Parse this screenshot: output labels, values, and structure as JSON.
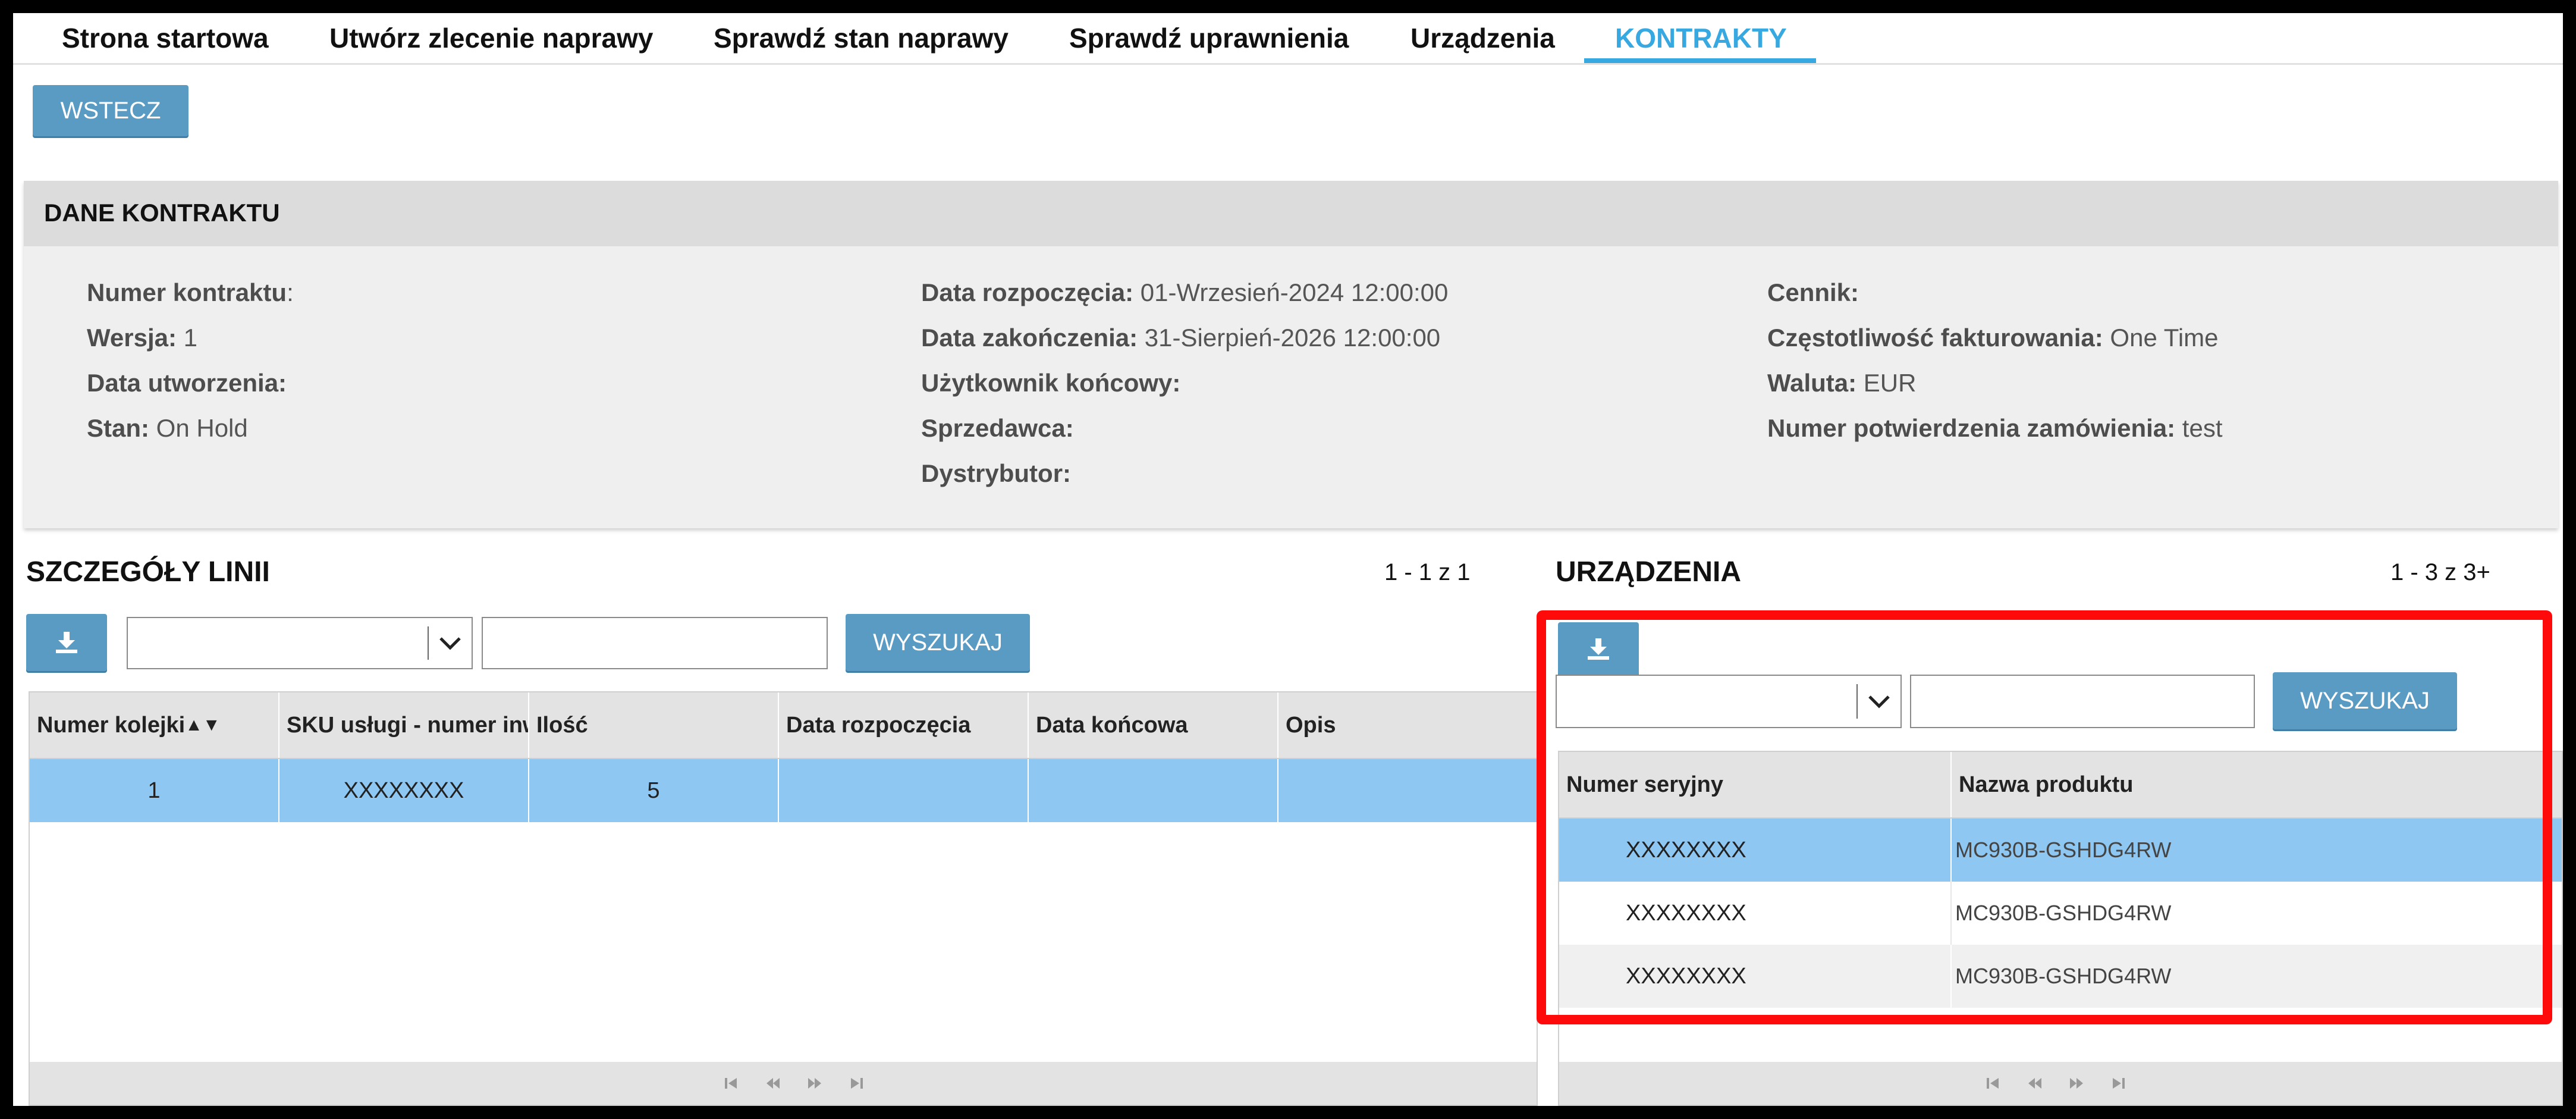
{
  "nav": {
    "tabs": [
      {
        "label": "Strona startowa"
      },
      {
        "label": "Utwórz zlecenie naprawy"
      },
      {
        "label": "Sprawdź stan naprawy"
      },
      {
        "label": "Sprawdź uprawnienia"
      },
      {
        "label": "Urządzenia"
      },
      {
        "label": "KONTRAKTY",
        "active": true
      }
    ]
  },
  "back_button": "WSTECZ",
  "contract": {
    "title": "DANE KONTRAKTU",
    "fields": [
      {
        "label": "Numer kontraktu",
        "value": ":"
      },
      {
        "label": "Wersja:",
        "value": " 1"
      },
      {
        "label": "Data utworzenia:",
        "value": ""
      },
      {
        "label": "Stan:",
        "value": " On Hold"
      },
      {
        "label": "Data rozpoczęcia:",
        "value": " 01-Wrzesień-2024 12:00:00"
      },
      {
        "label": "Data zakończenia:",
        "value": " 31-Sierpień-2026 12:00:00"
      },
      {
        "label": "Użytkownik końcowy:",
        "value": ""
      },
      {
        "label": "Sprzedawca:",
        "value": ""
      },
      {
        "label": "Dystrybutor:",
        "value": ""
      },
      {
        "label": "Cennik:",
        "value": ""
      },
      {
        "label": "Częstotliwość fakturowania:",
        "value": " One Time"
      },
      {
        "label": "Waluta:",
        "value": " EUR"
      },
      {
        "label": "Numer potwierdzenia zamówienia:",
        "value": " test"
      }
    ]
  },
  "line_details": {
    "title": "SZCZEGÓŁY LINII",
    "pager": "1 - 1 z 1",
    "search_label": "WYSZUKAJ",
    "columns": [
      "Numer kolejki",
      "SKU usługi - numer inw",
      "Ilość",
      "Data rozpoczęcia",
      "Data końcowa",
      "Opis"
    ],
    "sort_glyph": "▲▼",
    "rows": [
      {
        "queue": "1",
        "sku": "XXXXXXXX",
        "qty": "5",
        "start": "",
        "end": "",
        "desc": ""
      }
    ]
  },
  "devices": {
    "title": "URZĄDZENIA",
    "pager": "1 - 3 z 3+",
    "search_label": "WYSZUKAJ",
    "columns": [
      "Numer seryjny",
      "Nazwa produktu"
    ],
    "rows": [
      {
        "serial": "XXXXXXXX",
        "product": "MC930B-GSHDG4RW"
      },
      {
        "serial": "XXXXXXXX",
        "product": "MC930B-GSHDG4RW"
      },
      {
        "serial": "XXXXXXXX",
        "product": "MC930B-GSHDG4RW"
      }
    ]
  },
  "colors": {
    "accent": "#38a8e0",
    "button": "#5a9bc4",
    "selected_row": "#8ec7f2",
    "highlight": "#ff0a0a"
  },
  "icons": {
    "download": "download-icon",
    "dropdown": "chevron-down-icon",
    "pager": [
      "first-page-icon",
      "prev-page-icon",
      "next-page-icon",
      "last-page-icon"
    ]
  }
}
